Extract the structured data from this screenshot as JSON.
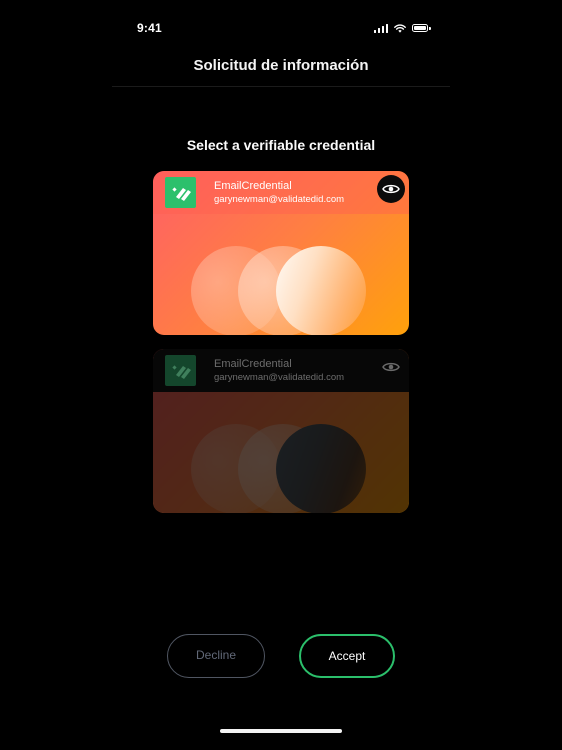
{
  "status_bar": {
    "time": "9:41"
  },
  "nav": {
    "title": "Solicitud de información"
  },
  "main": {
    "heading": "Select a verifiable credential",
    "credentials": [
      {
        "title": "EmailCredential",
        "subtitle": "garynewman@validatedid.com",
        "state": "selected",
        "icon": "validatedid-logo-icon",
        "action_icon": "eye-icon"
      },
      {
        "title": "EmailCredential",
        "subtitle": "garynewman@validatedid.com",
        "state": "dimmed",
        "icon": "validatedid-logo-icon",
        "action_icon": "eye-icon"
      }
    ]
  },
  "actions": {
    "decline_label": "Decline",
    "accept_label": "Accept"
  },
  "colors": {
    "background": "#000000",
    "accept_border": "#2bbf6b",
    "decline_border": "#505662",
    "logo_green": "#2cc06c"
  }
}
